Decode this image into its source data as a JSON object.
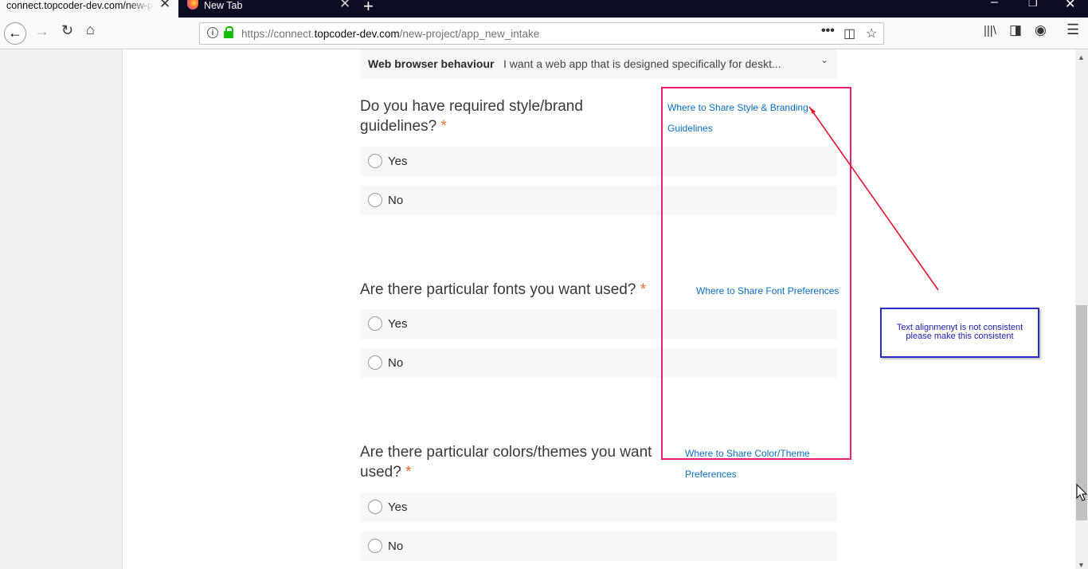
{
  "browser": {
    "tabs": [
      {
        "label": "connect.topcoder-dev.com/new-project/app_new_intake"
      },
      {
        "label": "New Tab"
      }
    ],
    "url_prefix": "https://connect.",
    "url_domain": "topcoder-dev.com",
    "url_path": "/new-project/app_new_intake"
  },
  "form": {
    "web_behaviour": {
      "label": "Web browser behaviour",
      "value": "I want a web app that is designed specifically for deskt..."
    },
    "questions": [
      {
        "line1": "Do you have required style/brand",
        "line2": "guidelines?",
        "required_mark": "*",
        "link_line1": "Where to Share Style & Branding",
        "link_line2": "Guidelines",
        "options": [
          "Yes",
          "No"
        ]
      },
      {
        "line1": "Are there particular fonts you want used?",
        "required_mark": "*",
        "link_line1": "Where to Share Font Preferences",
        "options": [
          "Yes",
          "No"
        ]
      },
      {
        "line1": "Are there particular colors/themes you want",
        "line2": "used?",
        "required_mark": "*",
        "link_line1": "Where to Share Color/Theme",
        "link_line2": "Preferences",
        "options": [
          "Yes",
          "No"
        ]
      }
    ]
  },
  "annotation": {
    "note_line1": "Text alignmenyt is not consistent",
    "note_line2": "please make this consistent"
  },
  "colors": {
    "required": "#ef6c2d",
    "link": "#0a6fc2",
    "highlight_box": "#e91e7a",
    "note_box": "#2a2ac8",
    "arrow": "#e8132b"
  }
}
